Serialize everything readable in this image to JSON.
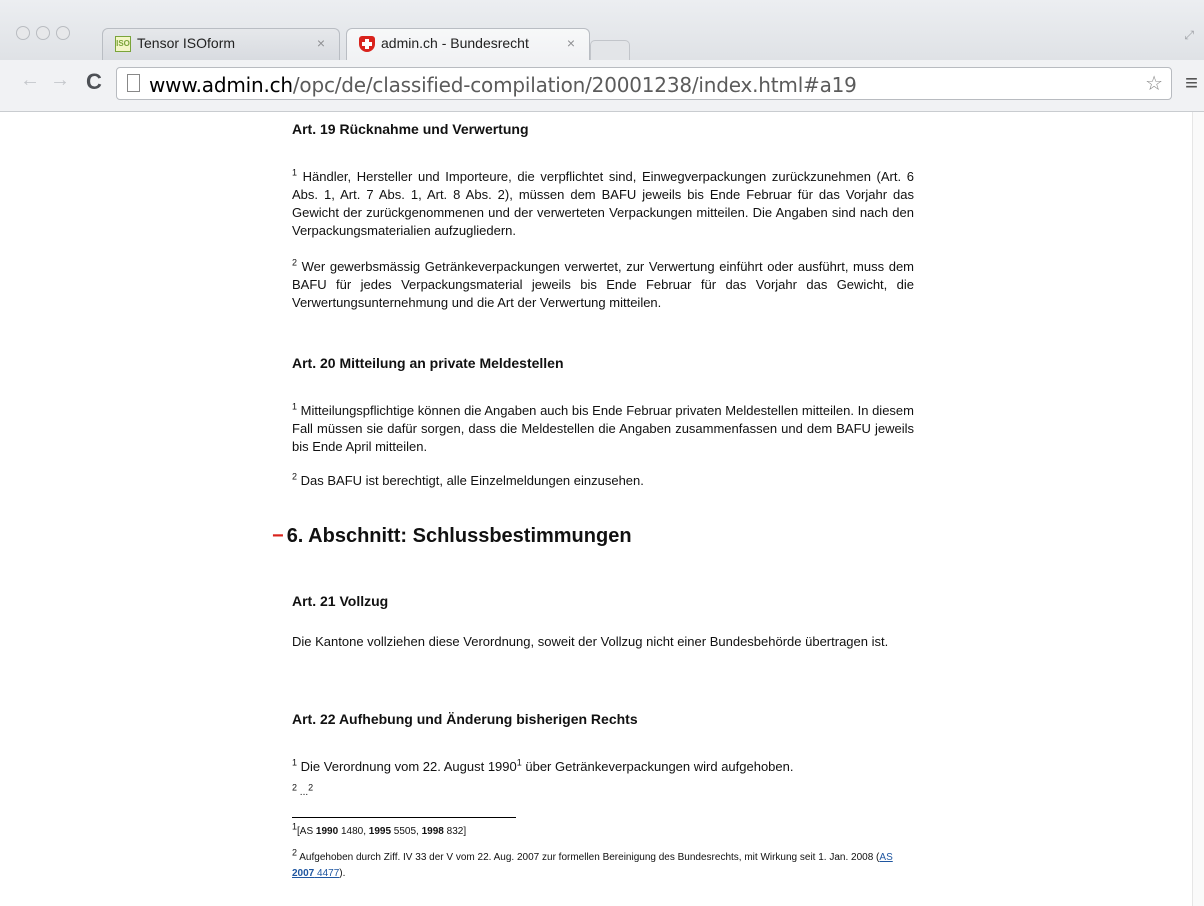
{
  "browser": {
    "tabs": [
      {
        "title": "Tensor ISOform",
        "close": "×",
        "favicon_text": "ISO"
      },
      {
        "title": "admin.ch - Bundesrecht",
        "close": "×"
      }
    ],
    "url_host": "www.admin.ch",
    "url_path": "/opc/de/classified-compilation/20001238/index.html#a19",
    "reload_glyph": "C",
    "back_glyph": "←",
    "forward_glyph": "→",
    "star_glyph": "☆",
    "menu_glyph": "≡"
  },
  "articles": {
    "a19": {
      "title": "Art. 19 Rücknahme und Verwertung",
      "p1_num": "1",
      "p1": "Händler, Hersteller und Importeure, die verpflichtet sind, Einwegverpackungen zurückzunehmen (Art. 6 Abs. 1, Art. 7 Abs. 1, Art. 8 Abs. 2), müssen dem BAFU jeweils bis Ende Februar für das Vorjahr das Gewicht der zurückgenommenen und der verwerteten Verpackungen mitteilen. Die Angaben sind nach den Verpackungsmaterialien aufzugliedern.",
      "p2_num": "2",
      "p2": "Wer gewerbsmässig Getränkeverpackungen verwertet, zur Verwertung einführt oder ausführt, muss dem BAFU für jedes Verpackungsmaterial jeweils bis Ende Februar für das Vorjahr das Gewicht, die Verwertungsunternehmung und die Art der Verwertung mitteilen."
    },
    "a20": {
      "title": "Art. 20 Mitteilung an private Meldestellen",
      "p1_num": "1",
      "p1": "Mitteilungspflichtige können die Angaben auch bis Ende Februar privaten Meldestellen mitteilen. In diesem Fall müssen sie dafür sorgen, dass die Meldestellen die Angaben zusammenfassen und dem BAFU jeweils bis Ende April mitteilen.",
      "p2_num": "2",
      "p2": "Das BAFU ist berechtigt, alle Einzelmeldungen einzusehen."
    },
    "section6": {
      "toggle": "−",
      "title": "6. Abschnitt: Schlussbestimmungen"
    },
    "a21": {
      "title": "Art. 21 Vollzug",
      "p1": "Die Kantone vollziehen diese Verordnung, soweit der Vollzug nicht einer Bundesbehörde übertragen ist."
    },
    "a22": {
      "title": "Art. 22 Aufhebung und Änderung bisherigen Rechts",
      "p1_num": "1",
      "p1_a": "Die Verordnung vom 22. August 1990",
      "p1_fn": "1",
      "p1_b": " über Getränkeverpackungen wird aufgehoben.",
      "p2_num": "2",
      "p2_text": "...",
      "p2_fn": "2"
    }
  },
  "footnotes": {
    "f1_num": "1",
    "f1_open": "[AS ",
    "f1_y1": "1990",
    "f1_n1": " 1480, ",
    "f1_y2": "1995",
    "f1_n2": " 5505, ",
    "f1_y3": "1998",
    "f1_n3": " 832]",
    "f2_num": "2",
    "f2_text": "Aufgehoben durch Ziff. IV 33 der V vom 22. Aug. 2007 zur formellen Bereinigung des Bundesrechts, mit Wirkung seit 1. Jan. 2008 (",
    "f2_link_as": "AS",
    "f2_link_year": "2007",
    "f2_link_num": "4477",
    "f2_close": ")."
  }
}
